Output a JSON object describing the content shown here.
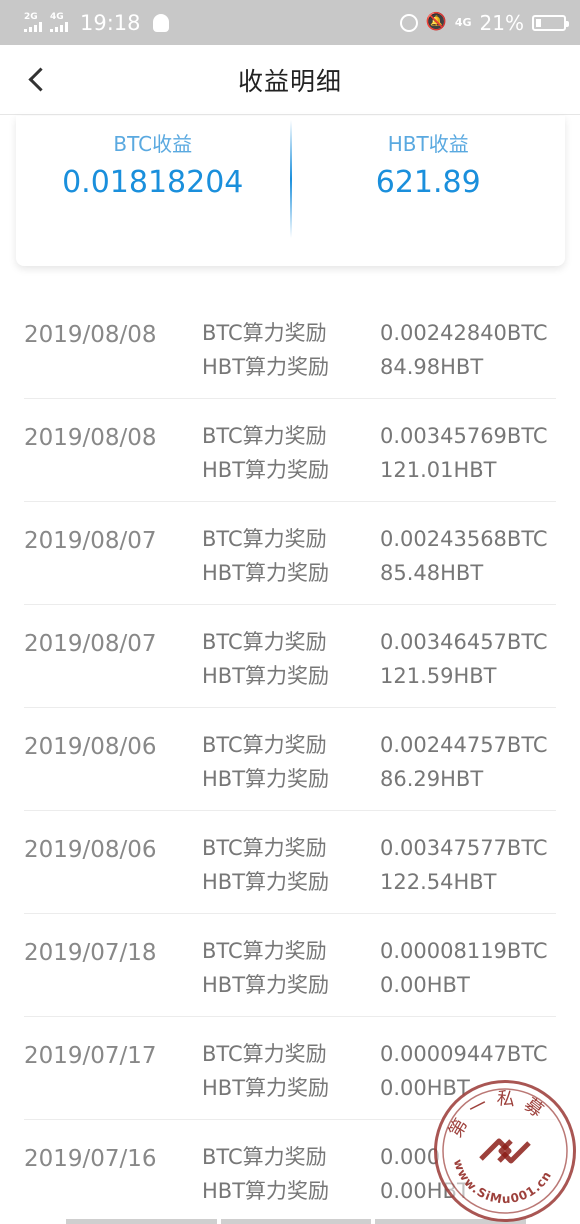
{
  "status_bar": {
    "sig1_label": "2G",
    "sig2_label": "4G",
    "time": "19:18",
    "net_label": "4G",
    "battery": "21%",
    "battery_level": 0.21
  },
  "nav": {
    "title": "收益明细"
  },
  "summary": {
    "btc_label": "BTC收益",
    "btc_value": "0.01818204",
    "hbt_label": "HBT收益",
    "hbt_value": "621.89"
  },
  "records": [
    {
      "date": "2019/08/08",
      "btc_type": "BTC算力奖励",
      "hbt_type": "HBT算力奖励",
      "btc_amount": "0.00242840BTC",
      "hbt_amount": "84.98HBT"
    },
    {
      "date": "2019/08/08",
      "btc_type": "BTC算力奖励",
      "hbt_type": "HBT算力奖励",
      "btc_amount": "0.00345769BTC",
      "hbt_amount": "121.01HBT"
    },
    {
      "date": "2019/08/07",
      "btc_type": "BTC算力奖励",
      "hbt_type": "HBT算力奖励",
      "btc_amount": "0.00243568BTC",
      "hbt_amount": "85.48HBT"
    },
    {
      "date": "2019/08/07",
      "btc_type": "BTC算力奖励",
      "hbt_type": "HBT算力奖励",
      "btc_amount": "0.00346457BTC",
      "hbt_amount": "121.59HBT"
    },
    {
      "date": "2019/08/06",
      "btc_type": "BTC算力奖励",
      "hbt_type": "HBT算力奖励",
      "btc_amount": "0.00244757BTC",
      "hbt_amount": "86.29HBT"
    },
    {
      "date": "2019/08/06",
      "btc_type": "BTC算力奖励",
      "hbt_type": "HBT算力奖励",
      "btc_amount": "0.00347577BTC",
      "hbt_amount": "122.54HBT"
    },
    {
      "date": "2019/07/18",
      "btc_type": "BTC算力奖励",
      "hbt_type": "HBT算力奖励",
      "btc_amount": "0.00008119BTC",
      "hbt_amount": "0.00HBT"
    },
    {
      "date": "2019/07/17",
      "btc_type": "BTC算力奖励",
      "hbt_type": "HBT算力奖励",
      "btc_amount": "0.00009447BTC",
      "hbt_amount": "0.00HBT"
    },
    {
      "date": "2019/07/16",
      "btc_type": "BTC算力奖励",
      "hbt_type": "HBT算力奖励",
      "btc_amount": "0.000",
      "hbt_amount": "0.00HBT"
    }
  ],
  "watermark": {
    "top_text": "第一私募",
    "bottom_text": "www.SiMu001.cn"
  },
  "colors": {
    "accent": "#1a8fdc",
    "label_blue": "#5aa9e0",
    "status_bar_bg": "#c8c8c8",
    "seal_red": "#8c1e19"
  },
  "icons": {
    "back": "chevron-left-icon",
    "alarm": "alarm-icon",
    "mute": "bell-off-icon",
    "battery": "battery-icon",
    "qq": "qq-penguin-icon"
  }
}
